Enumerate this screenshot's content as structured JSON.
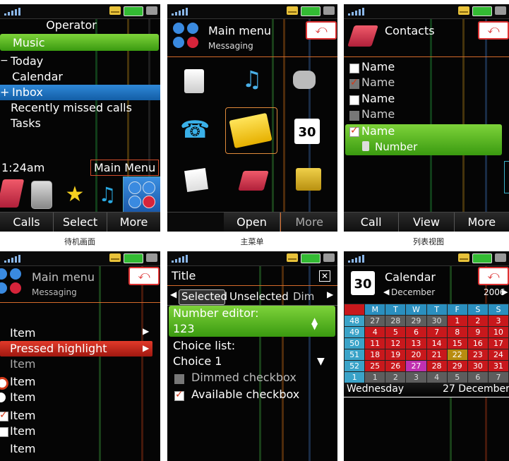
{
  "captions": {
    "s1": "待机画面",
    "s2": "主菜单",
    "s3": "列表视图"
  },
  "s1": {
    "operator": "Operator",
    "music": "Music",
    "today": "Today",
    "calendar": "Calendar",
    "inbox": "Inbox",
    "missed": "Recently missed calls",
    "tasks": "Tasks",
    "time": "1:24am",
    "main_menu": "Main Menu",
    "softkeys": [
      "Calls",
      "Select",
      "More"
    ]
  },
  "s2": {
    "title": "Main menu",
    "subtitle": "Messaging",
    "softkeys": [
      "Open",
      "More"
    ],
    "calendar_num": "30"
  },
  "s3": {
    "title": "Contacts",
    "items": [
      "Name",
      "Name",
      "Name",
      "Name",
      "Name"
    ],
    "number": "Number",
    "softkeys": [
      "Call",
      "View",
      "More"
    ]
  },
  "s4": {
    "title": "Main menu",
    "subtitle": "Messaging",
    "items": [
      "Item",
      "Pressed highlight",
      "Item",
      "Item",
      "Item",
      "Item",
      "Item",
      "Item"
    ]
  },
  "s5": {
    "title": "Title",
    "tabs": [
      "Selected",
      "Unselected",
      "Dim"
    ],
    "editor_label": "Number editor:",
    "editor_value": "123",
    "choice_label": "Choice list:",
    "choice_value": "Choice 1",
    "dimmed": "Dimmed checkbox",
    "available": "Available checkbox"
  },
  "s6": {
    "title": "Calendar",
    "month": "December",
    "year": "2006",
    "calendar_num": "30",
    "days": [
      "M",
      "T",
      "W",
      "T",
      "F",
      "S",
      "S"
    ],
    "weeks": [
      {
        "wk": "48",
        "d": [
          "27",
          "28",
          "29",
          "30",
          "1",
          "2",
          "3"
        ]
      },
      {
        "wk": "49",
        "d": [
          "4",
          "5",
          "6",
          "7",
          "8",
          "9",
          "10"
        ]
      },
      {
        "wk": "50",
        "d": [
          "11",
          "12",
          "13",
          "14",
          "15",
          "16",
          "17"
        ]
      },
      {
        "wk": "51",
        "d": [
          "18",
          "19",
          "20",
          "21",
          "22",
          "23",
          "24"
        ]
      },
      {
        "wk": "52",
        "d": [
          "25",
          "26",
          "27",
          "28",
          "29",
          "30",
          "31"
        ]
      },
      {
        "wk": "1",
        "d": [
          "1",
          "2",
          "3",
          "4",
          "5",
          "6",
          "7"
        ]
      }
    ],
    "weekday": "Wednesday",
    "date": "27 December"
  },
  "colors": {
    "green": "#5bb51e",
    "blue": "#1f6fbf",
    "red": "#c8181c"
  }
}
